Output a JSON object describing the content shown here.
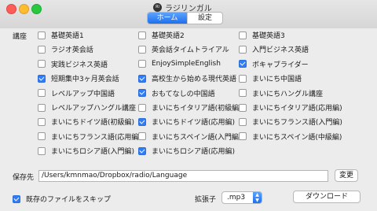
{
  "window": {
    "title": "ラジリンガル",
    "app_icon_text": "Rl"
  },
  "tabs": [
    {
      "label": "ホーム",
      "selected": true
    },
    {
      "label": "設定",
      "selected": false
    }
  ],
  "courses_label": "講座",
  "courses": [
    {
      "label": "基礎英語1",
      "checked": false
    },
    {
      "label": "基礎英語2",
      "checked": false
    },
    {
      "label": "基礎英語3",
      "checked": false
    },
    {
      "label": "ラジオ英会話",
      "checked": false
    },
    {
      "label": "英会話タイムトライアル",
      "checked": false
    },
    {
      "label": "入門ビジネス英語",
      "checked": false
    },
    {
      "label": "実践ビジネス英語",
      "checked": false
    },
    {
      "label": "EnjoySimpleEnglish",
      "checked": false
    },
    {
      "label": "ボキャブライダー",
      "checked": true
    },
    {
      "label": "短期集中3ヶ月英会話",
      "checked": true
    },
    {
      "label": "高校生から始める現代英語",
      "checked": true
    },
    {
      "label": "まいにち中国語",
      "checked": false
    },
    {
      "label": "レベルアップ中国語",
      "checked": false
    },
    {
      "label": "おもてなしの中国語",
      "checked": true
    },
    {
      "label": "まいにちハングル講座",
      "checked": false
    },
    {
      "label": "レベルアップハングル講座",
      "checked": false
    },
    {
      "label": "まいにちイタリア語(初級編)",
      "checked": false
    },
    {
      "label": "まいにちイタリア語(応用編)",
      "checked": false
    },
    {
      "label": "まいにちドイツ語(初級編)",
      "checked": false
    },
    {
      "label": "まいにちドイツ語(応用編)",
      "checked": true
    },
    {
      "label": "まいにちフランス語(入門編)",
      "checked": false
    },
    {
      "label": "まいにちフランス語(応用編)",
      "checked": false
    },
    {
      "label": "まいにちスペイン語(入門編)",
      "checked": false
    },
    {
      "label": "まいにちスペイン語(中級編)",
      "checked": false
    },
    {
      "label": "まいにちロシア語(入門編)",
      "checked": false
    },
    {
      "label": "まいにちロシア語(応用編)",
      "checked": true
    }
  ],
  "save_path": {
    "label": "保存先",
    "value": "/Users/kmnmao/Dropbox/radio/Language",
    "change_button": "変更"
  },
  "skip_existing": {
    "label": "既存のファイルをスキップ",
    "checked": true
  },
  "extension": {
    "label": "拡張子",
    "value": ".mp3"
  },
  "download_button": "ダウンロード",
  "colors": {
    "accent": "#1c6ff0",
    "checkbox_on": "#2f7cf6"
  }
}
